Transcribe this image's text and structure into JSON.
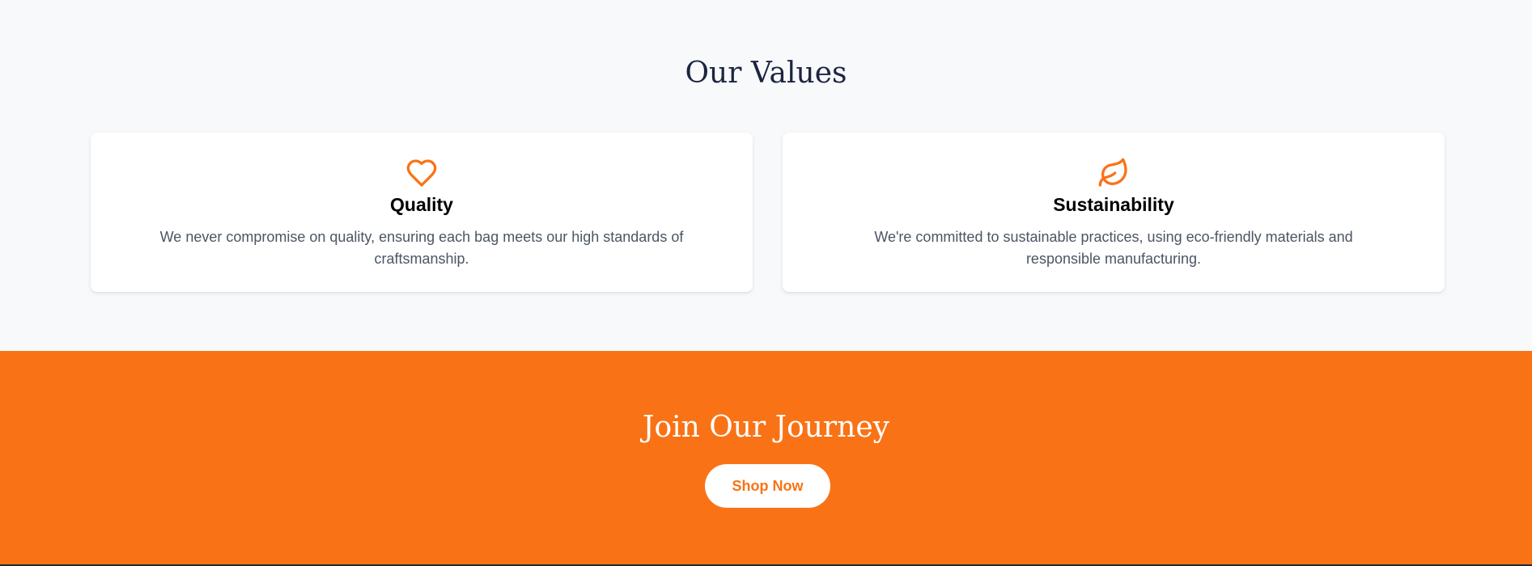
{
  "values": {
    "title": "Our Values",
    "cards": [
      {
        "icon": "heart-icon",
        "title": "Quality",
        "text": "We never compromise on quality, ensuring each bag meets our high standards of craftsmanship."
      },
      {
        "icon": "leaf-icon",
        "title": "Sustainability",
        "text": "We're committed to sustainable practices, using eco-friendly materials and responsible manufacturing."
      }
    ]
  },
  "join": {
    "title": "Join Our Journey",
    "button_label": "Shop Now"
  },
  "colors": {
    "accent": "#f97316",
    "page_background": "#f8f9fb",
    "heading": "#1c2540",
    "body_text": "#4b5563",
    "card_background": "#ffffff"
  }
}
